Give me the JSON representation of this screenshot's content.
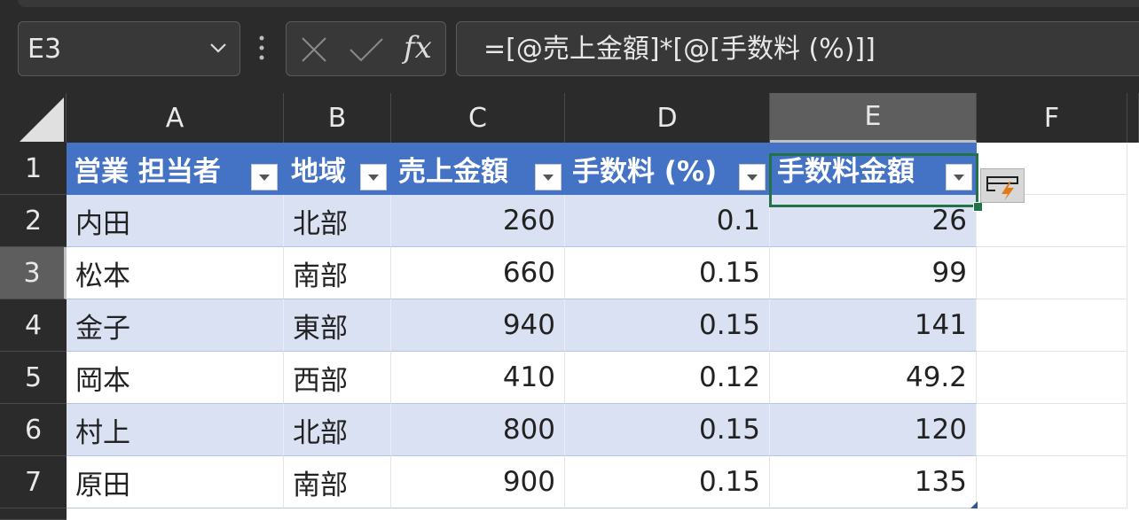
{
  "name_box": {
    "value": "E3"
  },
  "formula_bar": {
    "fx_label": "fx",
    "formula": "=[@売上金額]*[@[手数料 (%)]]"
  },
  "columns": [
    "A",
    "B",
    "C",
    "D",
    "E",
    "F"
  ],
  "selected_column": "E",
  "rows": [
    "1",
    "2",
    "3",
    "4",
    "5",
    "6",
    "7"
  ],
  "selected_row": "3",
  "table": {
    "headers": [
      "営業 担当者",
      "地域",
      "売上金額",
      "手数料 (%)",
      "手数料金額"
    ],
    "rows": [
      [
        "内田",
        "北部",
        "260",
        "0.1",
        "26"
      ],
      [
        "松本",
        "南部",
        "660",
        "0.15",
        "99"
      ],
      [
        "金子",
        "東部",
        "940",
        "0.15",
        "141"
      ],
      [
        "岡本",
        "西部",
        "410",
        "0.12",
        "49.2"
      ],
      [
        "村上",
        "北部",
        "800",
        "0.15",
        "120"
      ],
      [
        "原田",
        "南部",
        "900",
        "0.15",
        "135"
      ]
    ]
  },
  "colors": {
    "header_fill": "#4472c4",
    "band_fill": "#d9e1f2",
    "selection": "#217346",
    "chrome": "#2b2b2b"
  }
}
